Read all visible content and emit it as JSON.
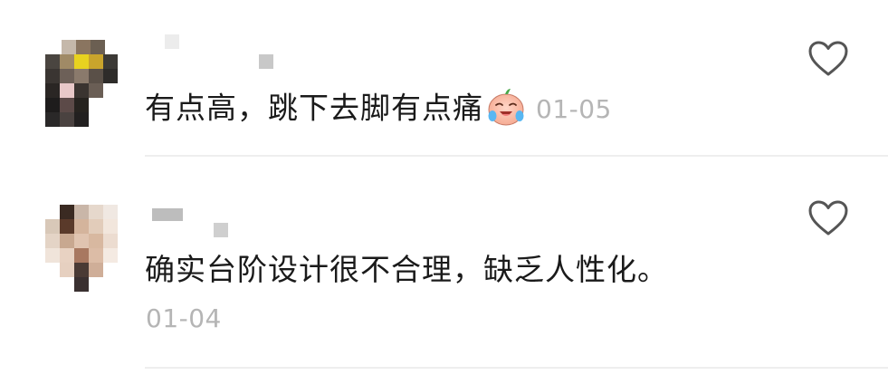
{
  "comments": [
    {
      "text": "有点高，跳下去脚有点痛",
      "emoji": "crying-laughing-face-emoji",
      "date": "01-05",
      "username_visible": "pixelated",
      "liked": false
    },
    {
      "text": "确实台阶设计很不合理，缺乏人性化。",
      "date": "01-04",
      "username_visible": "pixelated",
      "liked": false
    }
  ],
  "colors": {
    "text": "#1a1a1a",
    "secondary": "#b5b5b5",
    "divider": "#eeeeee",
    "icon": "#555555"
  },
  "icons": {
    "like": "heart-outline-icon"
  }
}
